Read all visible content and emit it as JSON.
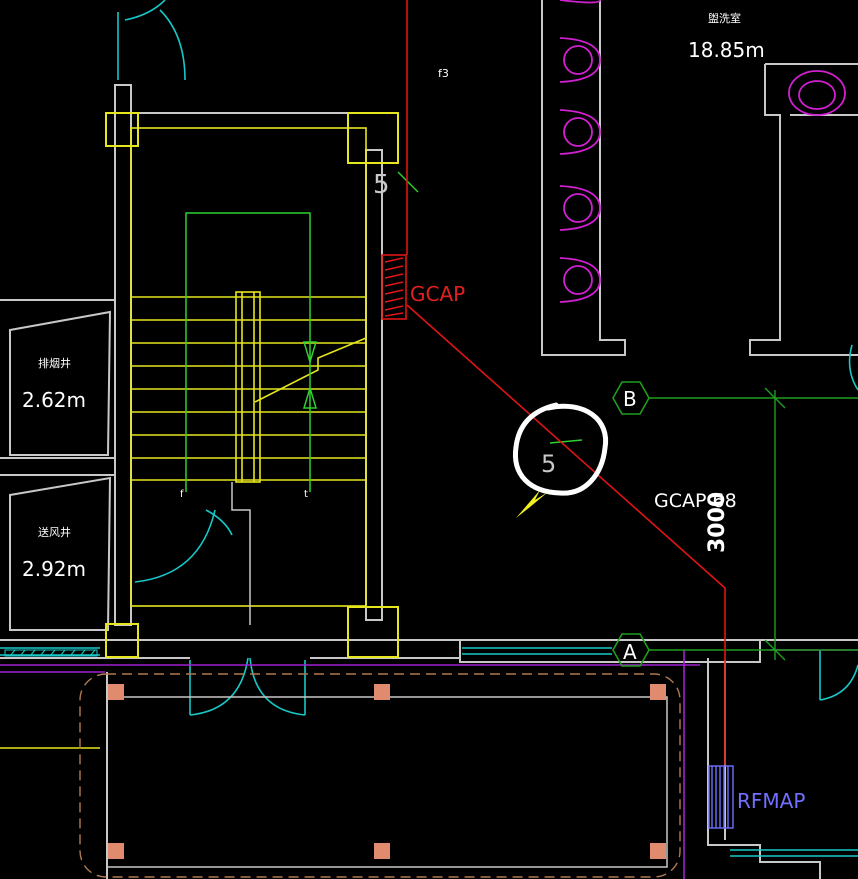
{
  "labels": {
    "room_top_right": {
      "name": "盥洗室",
      "area": "18.85m"
    },
    "room_left_upper": {
      "name": "排烟井",
      "area": "2.62m"
    },
    "room_left_lower": {
      "name": "送风井",
      "area": "2.92m"
    },
    "mark_f3": "f3",
    "number_top": "5",
    "gcap_top": "GCAP",
    "number_circled": "5",
    "gcap_mid": "GCAP 68",
    "dimension": "3000",
    "axis_b": "B",
    "axis_a": "A",
    "rfmap": "RFMAP",
    "stair_mark_left": "f",
    "stair_mark_right": "t"
  },
  "colors": {
    "background": "#000000",
    "wall": "#c8c8c8",
    "stair": "#e6e61e",
    "duct_red": "#e01414",
    "grid_green": "#1e9e1e",
    "bright_green": "#2fd02f",
    "door_cyan": "#18c8c8",
    "fixture_magenta": "#d020d0",
    "purple_line": "#a020d0",
    "column_fill": "#e08a6e",
    "dash_outline": "#b07a50",
    "annot_white": "#ffffff",
    "arrow_yellow": "#f0f020",
    "label_blue": "#7070ff",
    "label_red": "#e02020"
  }
}
